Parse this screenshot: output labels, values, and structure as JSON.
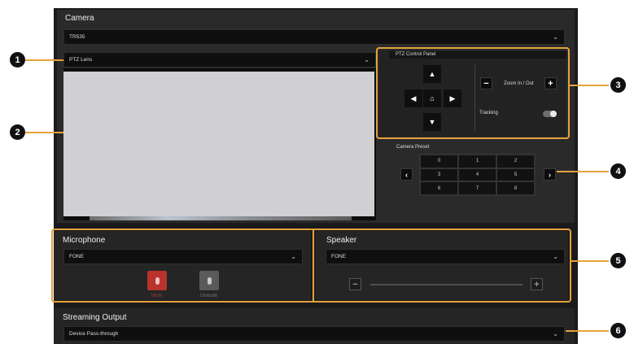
{
  "camera": {
    "title": "Camera",
    "device_value": "TR535",
    "lens_value": "PTZ Lens"
  },
  "ptz": {
    "panel_title": "PTZ Control Panel",
    "zoom_label": "Zoom In / Out",
    "tracking_label": "Tracking",
    "tracking_on": false
  },
  "preset": {
    "title": "Camera Preset",
    "cells": [
      "0",
      "1",
      "2",
      "3",
      "4",
      "5",
      "6",
      "7",
      "8"
    ]
  },
  "microphone": {
    "title": "Microphone",
    "device_value": "FONE",
    "mute_label": "Mute",
    "unmute_label": "Unmute"
  },
  "speaker": {
    "title": "Speaker",
    "device_value": "FONE"
  },
  "streaming": {
    "title": "Streaming Output",
    "value": "Device Pass-through"
  },
  "callouts": [
    "1",
    "2",
    "3",
    "4",
    "5",
    "6"
  ],
  "colors": {
    "accent": "#e6a23c",
    "mute_red": "#b8332b",
    "panel_bg": "#2a2a2a"
  }
}
